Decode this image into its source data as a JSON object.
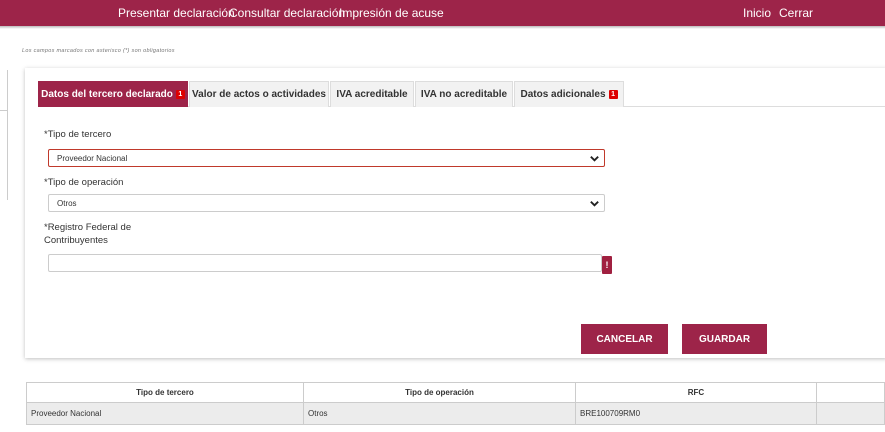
{
  "topbar": {
    "nav_left": [
      "Presentar declaración",
      "Consultar declaración",
      "Impresión de acuse"
    ],
    "nav_right": [
      "Inicio",
      "Cerrar"
    ],
    "color": "#9d2449"
  },
  "note": "Los campos marcados con asterisco (*) son obligatorios",
  "tabs": [
    {
      "label": "Datos del tercero declarado",
      "badge": "1",
      "active": true
    },
    {
      "label": "Valor de actos o actividades",
      "badge": "",
      "active": false
    },
    {
      "label": "IVA acreditable",
      "badge": "",
      "active": false
    },
    {
      "label": "IVA no acreditable",
      "badge": "",
      "active": false
    },
    {
      "label": "Datos adicionales",
      "badge": "1",
      "active": false
    }
  ],
  "form": {
    "tipo_tercero": {
      "label": "*Tipo de tercero",
      "value": "Proveedor Nacional"
    },
    "tipo_operacion": {
      "label": "*Tipo de operación",
      "value": "Otros"
    },
    "rfc": {
      "label_line1": "*Registro Federal de",
      "label_line2": "Contribuyentes",
      "value": "",
      "error_mark": "!"
    }
  },
  "buttons": {
    "cancel": "CANCELAR",
    "save": "GUARDAR"
  },
  "table": {
    "headers": [
      "Tipo de tercero",
      "Tipo de operación",
      "RFC",
      ""
    ],
    "rows": [
      [
        "Proveedor Nacional",
        "Otros",
        "BRE100709RM0",
        ""
      ]
    ]
  }
}
